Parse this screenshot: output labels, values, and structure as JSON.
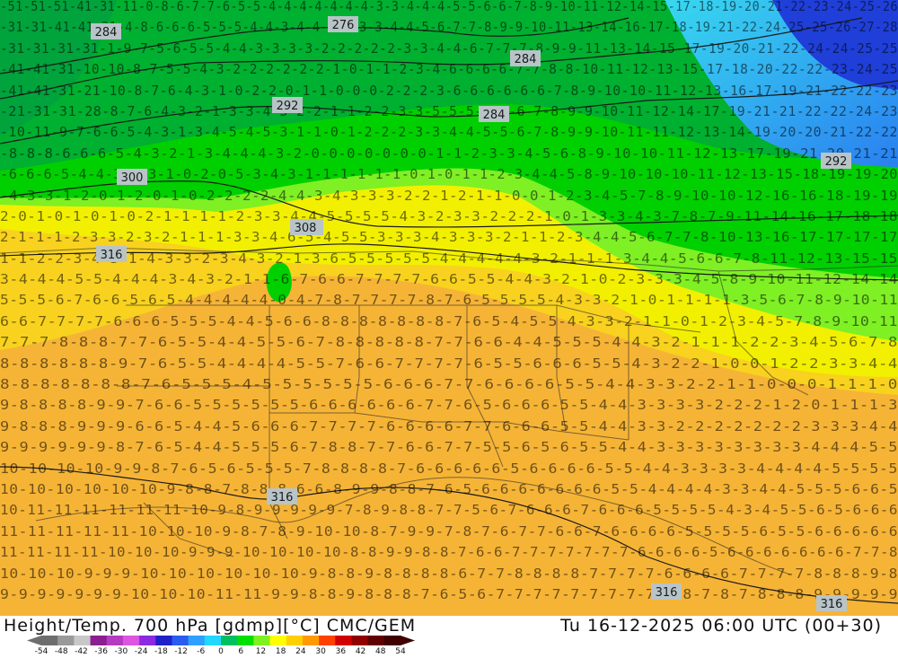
{
  "title": {
    "left": "Height/Temp. 700 hPa [gdmp][°C] CMC/GEM",
    "right": "Tu 16-12-2025 06:00 UTC (00+30)"
  },
  "contour_labels": [
    "284",
    "276",
    "284",
    "292",
    "284",
    "292",
    "300",
    "308",
    "308",
    "316",
    "316",
    "316",
    "316"
  ],
  "colorbar": {
    "ticks": [
      "-54",
      "-48",
      "-42",
      "-36",
      "-30",
      "-24",
      "-18",
      "-12",
      "-6",
      "0",
      "6",
      "12",
      "18",
      "24",
      "30",
      "36",
      "42",
      "48",
      "54"
    ],
    "colors": [
      "#6e6e6e",
      "#9a9a9a",
      "#c8c8c8",
      "#8b1f8f",
      "#b43cc0",
      "#dd55e0",
      "#8a2be2",
      "#2020c8",
      "#2a5cf0",
      "#2fa0ff",
      "#22d8ff",
      "#00c060",
      "#00e000",
      "#80f020",
      "#ffff00",
      "#ffd000",
      "#ff9a00",
      "#ff4000",
      "#d00000",
      "#900000",
      "#600000",
      "#400000"
    ]
  },
  "colors": {
    "cold_deep": "#1f2fd8",
    "cold": "#2a9ef0",
    "cyan": "#3ee0f0",
    "green_dark": "#00b030",
    "green": "#00d000",
    "lime": "#90f030",
    "yellow": "#f4f000",
    "gold": "#f8d020",
    "orange": "#f6b030"
  },
  "grid_rows": [
    "-51-51-51-41-31-11-0-8-6-7-7-6-5-5-4-4-4-4-4-4-4-3-3-4-4-4-5-5-6-6-7-8-9-10-11-12-14-15-17-18-19-20-21-22-23-24-25-26",
    "-31-31-41-41-31-4-8-6-6-6-5-5-5-4-4-3-4-4-4-3-3-3-4-4-5-6-7-7-8-9-9-10-11-13-14-16-17-18-19-21-22-24-25-25-26-27-28",
    "-31-31-31-31-1-9-7-5-6-5-5-4-4-3-3-3-3-2-2-2-2-2-3-3-4-4-6-7-7-7-8-9-9-11-13-14-15-17-19-20-21-22-24-24-25-25",
    "-41-41-31-10-10-8-7-5-5-4-3-2-2-2-2-2-2-1-0-1-1-2-3-4-6-6-6-6-7-7-8-8-10-11-12-13-15-17-18-20-22-22-23-24-25",
    "-41-41-31-21-10-8-7-6-4-3-1-0-2-2-0-1-1-0-0-0-2-2-2-3-6-6-6-6-6-6-7-8-9-10-10-11-12-13-16-17-19-21-22-22-23",
    "-21-31-31-28-8-7-6-4-3-2-1-3-3-4-3-2-2-1-1-2-2-3-3-5-5-5-5-5-6-7-8-9-9-10-11-12-14-17-19-21-21-22-22-24-23",
    "-10-11-9-7-6-6-5-4-3-1-3-4-5-4-5-3-1-1-0-1-2-2-2-3-3-4-4-5-5-6-7-8-9-9-10-11-11-12-13-14-19-20-20-21-22-22",
    "-8-8-8-6-6-6-5-4-3-2-1-3-4-4-4-3-2-0-0-0-0-0-0-0-1-1-2-3-3-4-5-6-8-9-10-10-11-12-13-17-19-21-20-21-21",
    "-6-6-6-5-4-4-3-3-3-1-0-2-0-5-3-4-3-1-1-1-1-1-1-0-1-0-1-1-2-3-4-4-5-8-9-10-10-10-11-12-13-15-18-19-19-20",
    "-4-3-3-1-2-0-1-2-0-1-0-2-2-2-2-4-4-3-4-3-3-3-2-2-1-2-1-1-0-0-1-2-3-4-5-7-8-9-10-10-12-16-16-18-19-19",
    "2-0-1-0-1-0-1-0-2-1-1-1-1-2-3-3-4-4-5-5-5-5-4-3-2-3-3-2-2-2-1-0-1-3-3-4-3-7-8-7-9-11-14-16-17-18-18",
    "2-1-1-1-2-3-3-2-3-2-1-1-1-3-3-4-6-5-4-5-5-3-3-3-4-3-3-3-2-1-1-2-3-4-4-5-6-7-7-8-10-13-16-17-17-17-17",
    "1-1-2-2-3-4-3-1-4-3-3-2-3-4-3-2-1-3-6-5-5-5-5-5-4-4-4-4-4-3-2-1-1-1-3-4-4-5-6-6-7-8-11-12-13-15-15",
    "3-4-4-4-5-5-4-4-4-3-4-3-2-1-1-6-7-6-6-7-7-7-7-6-6-5-5-4-4-3-2-1-0-2-3-3-3-4-5-8-9-10-11-12-14-14",
    "5-5-5-6-7-6-6-5-6-5-4-4-4-4-4-0-4-7-8-7-7-7-7-8-7-6-5-5-5-5-4-3-3-2-1-0-1-1-1-1-3-5-6-7-8-9-10-11",
    "6-6-7-7-7-7-6-6-6-5-5-5-4-4-5-6-6-8-8-8-8-8-8-8-7-6-5-4-5-5-4-3-3-2-1-1-0-1-2-3-4-5-7-8-9-10-11",
    "7-7-7-8-8-8-7-7-6-5-5-4-4-5-5-6-7-8-8-8-8-8-7-7-6-6-4-4-5-5-5-4-4-3-2-1-1-1-2-2-3-4-5-6-7-8",
    "8-8-8-8-8-8-9-7-6-5-5-4-4-4-4-5-5-7-6-6-7-7-7-7-6-5-5-6-6-6-5-5-4-3-2-2-1-0-0-1-2-2-3-3-4-4",
    "8-8-8-8-8-8-8-7-6-5-5-5-4-5-5-5-5-5-5-6-6-6-7-7-6-6-6-6-5-5-4-4-3-3-2-2-1-1-0-0-0-1-1-1-0",
    "9-8-8-8-8-9-9-7-6-6-5-5-5-5-5-5-6-6-6-6-6-6-7-7-6-5-6-6-6-5-5-4-4-3-3-3-3-2-2-2-1-2-0-1-1-1-3",
    "9-8-8-8-9-9-9-6-6-5-4-4-5-6-6-6-7-7-7-7-6-6-6-6-7-7-6-6-6-5-5-4-4-3-3-2-2-2-2-2-2-2-3-3-3-4-4",
    "9-9-9-9-9-9-8-7-6-5-4-4-5-5-5-6-7-8-8-7-7-6-6-7-7-5-5-6-5-6-5-5-4-4-3-3-3-3-3-3-3-3-4-4-4-5-5",
    "10-10-10-10-9-9-8-7-6-5-6-5-5-5-7-8-8-8-8-7-6-6-6-6-6-5-6-6-6-6-5-5-4-4-3-3-3-3-4-4-4-4-5-5-5-5",
    "10-10-10-10-10-10-9-8-8-7-8-8-8-6-6-8-9-9-8-8-7-6-5-6-6-6-6-6-6-6-5-5-4-4-4-4-3-3-4-4-5-5-5-6-6-5",
    "10-11-11-11-11-11-11-10-9-8-9-9-9-9-9-7-8-9-8-8-7-7-5-6-7-6-6-6-7-6-6-6-5-5-5-5-4-3-4-5-5-6-5-6-6-6",
    "11-11-11-11-11-10-10-10-9-8-7-8-9-10-10-8-7-9-9-7-8-7-6-7-7-6-6-7-6-6-6-6-5-5-5-5-6-5-5-6-6-6-6-6",
    "11-11-11-11-10-10-10-9-9-9-10-10-10-10-8-8-9-9-8-8-7-6-6-7-7-7-7-7-7-7-6-6-6-6-5-6-6-6-6-6-6-6-7-7-8",
    "10-10-10-9-9-9-10-10-10-10-10-10-9-8-8-9-8-8-8-8-6-7-7-8-8-8-8-7-7-7-7-6-6-6-6-7-7-7-7-8-8-8-9-8",
    "9-9-9-9-9-9-9-10-10-10-11-11-9-9-8-8-9-8-8-8-7-6-5-6-7-7-7-7-7-7-7-7-7-7-8-7-8-7-8-8-8-9-9-9-9-9"
  ]
}
